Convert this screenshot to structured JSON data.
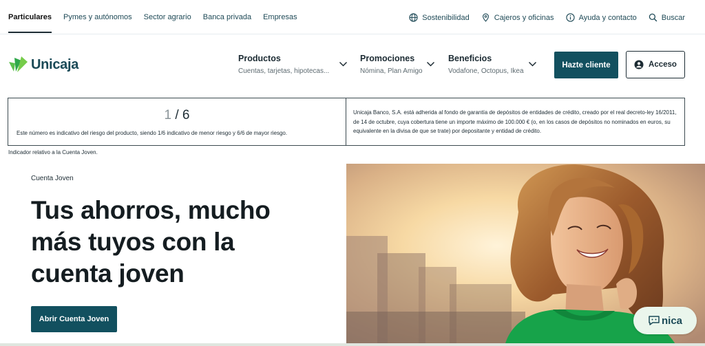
{
  "topnav": {
    "items": [
      {
        "label": "Particulares",
        "active": true
      },
      {
        "label": "Pymes y autónomos"
      },
      {
        "label": "Sector agrario"
      },
      {
        "label": "Banca privada"
      },
      {
        "label": "Empresas"
      }
    ]
  },
  "toplinks": {
    "sostenibilidad": {
      "label": "Sostenibilidad",
      "icon": "globe-icon"
    },
    "cajeros": {
      "label": "Cajeros y oficinas",
      "icon": "location-pin-icon"
    },
    "ayuda": {
      "label": "Ayuda y contacto",
      "icon": "info-icon"
    },
    "buscar": {
      "label": "Buscar",
      "icon": "search-icon"
    }
  },
  "header": {
    "logo_text": "Unicaja",
    "menu": [
      {
        "title": "Productos",
        "subtitle": "Cuentas, tarjetas, hipotecas..."
      },
      {
        "title": "Promociones",
        "subtitle": "Nómina, Plan Amigo"
      },
      {
        "title": "Beneficios",
        "subtitle": "Vodafone, Octopus, Ikea"
      }
    ],
    "cta_label": "Hazte cliente",
    "login_label": "Acceso"
  },
  "risk": {
    "current": "1",
    "separator": " / ",
    "max": "6",
    "note": "Este número es indicativo del riesgo del producto, siendo 1/6 indicativo de menor riesgo y 6/6 de mayor riesgo.",
    "guarantee": "Unicaja Banco, S.A. está adherida al fondo de garantía de depósitos de entidades de crédito, creado por el real decreto-ley 16/2011, de 14 de octubre, cuya cobertura tiene un importe máximo de 100.000 € (o, en los casos de depósitos no nominados en euros, su equivalente en la divisa de que se trate) por depositante y entidad de crédito.",
    "indicator_label": "Indicador relativo a la Cuenta Joven."
  },
  "hero": {
    "eyebrow": "Cuenta Joven",
    "title": "Tus ahorros, mucho más tuyos con la cuenta joven",
    "cta_label": "Abrir Cuenta Joven"
  },
  "assistant": {
    "label": "nica"
  },
  "colors": {
    "brand_teal": "#12505f",
    "logo_green": "#3fb549",
    "text_dark": "#1c2b33"
  }
}
